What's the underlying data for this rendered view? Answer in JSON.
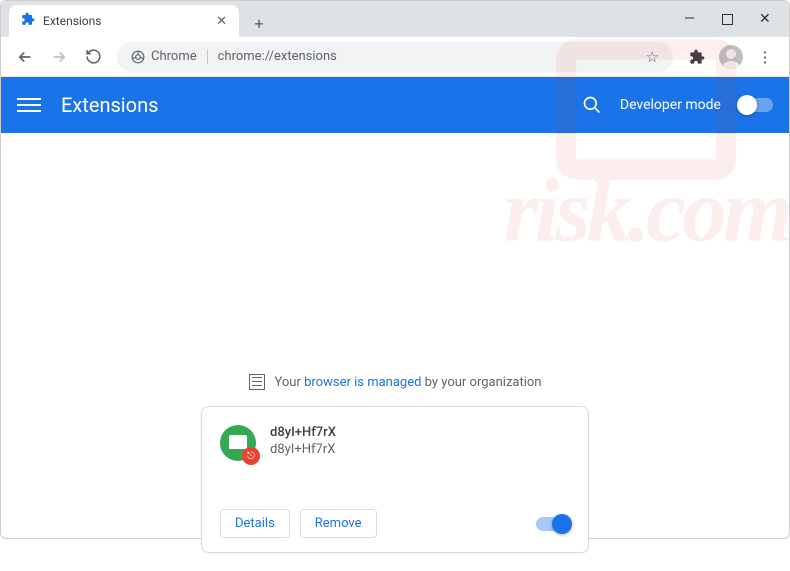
{
  "window": {
    "tab_title": "Extensions"
  },
  "toolbar": {
    "chrome_label": "Chrome",
    "url": "chrome://extensions"
  },
  "header": {
    "title": "Extensions",
    "developer_mode": "Developer mode"
  },
  "managed_banner": {
    "prefix": "Your ",
    "link": "browser is managed",
    "suffix": " by your organization"
  },
  "extension": {
    "name": "d8yI+Hf7rX",
    "description": "d8yI+Hf7rX",
    "details_label": "Details",
    "remove_label": "Remove",
    "enabled": true
  },
  "watermark": {
    "text": "risk.com"
  }
}
